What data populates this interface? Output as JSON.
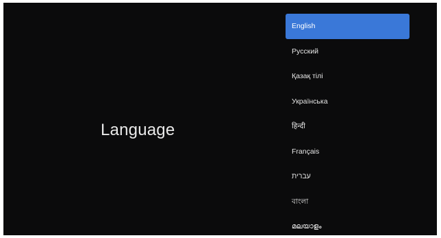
{
  "screen": {
    "title": "Language"
  },
  "accent_color": "#3a78d8",
  "languages": {
    "selected_index": 0,
    "items": [
      {
        "label": "English"
      },
      {
        "label": "Русский"
      },
      {
        "label": "Қазақ тілі"
      },
      {
        "label": "Українська"
      },
      {
        "label": "हिन्दी"
      },
      {
        "label": "Français"
      },
      {
        "label": "עברית"
      },
      {
        "label": "বাংলা"
      },
      {
        "label": "മലയാളം"
      }
    ]
  }
}
